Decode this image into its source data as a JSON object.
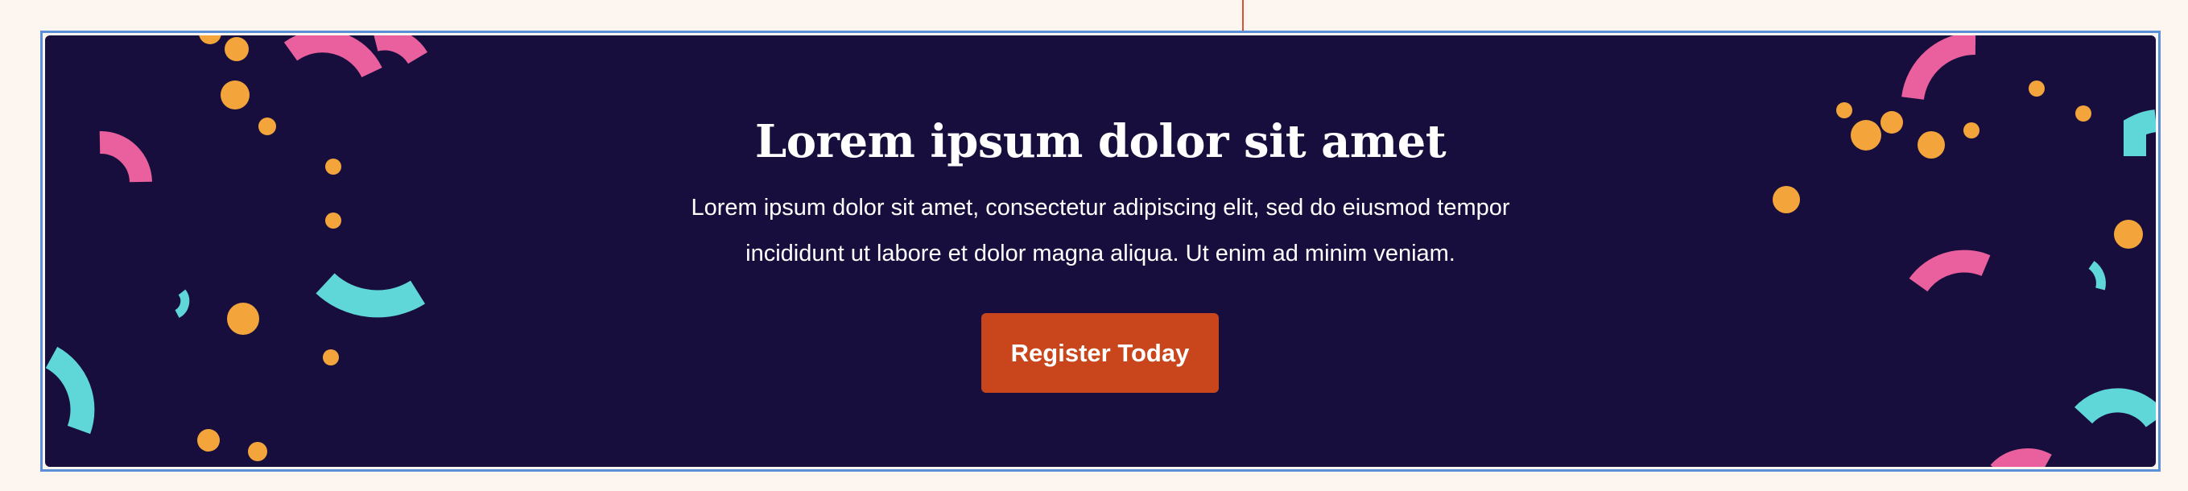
{
  "banner": {
    "title": "Lorem ipsum dolor sit amet",
    "description": "Lorem ipsum dolor sit amet, consectetur adipiscing elit, sed do eiusmod tempor incididunt ut labore et dolor magna aliqua. Ut enim ad minim veniam.",
    "cta_label": "Register Today"
  },
  "colors": {
    "page_background": "#fdf5ef",
    "banner_background": "#170e3d",
    "selection_outline": "#5b8fd8",
    "guide_line": "#d9532f",
    "button": "#c9461c",
    "confetti_pink": "#ea5f9d",
    "confetti_teal": "#5fd6d8",
    "confetti_orange": "#f3a53b"
  },
  "decoration": {
    "icon": "confetti-pattern"
  }
}
